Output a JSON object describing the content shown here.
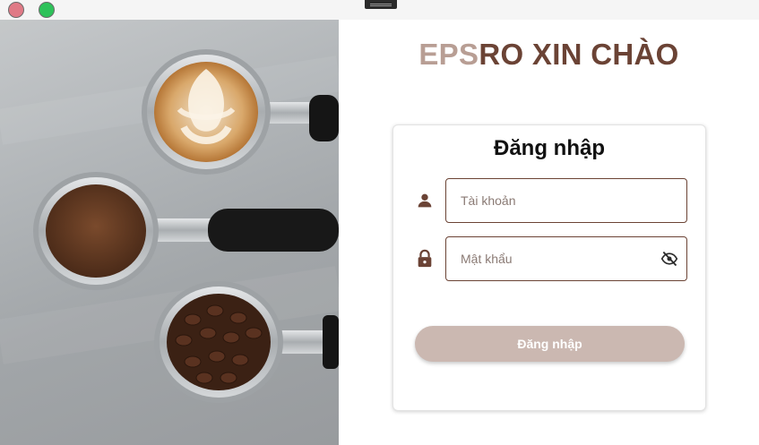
{
  "window": {
    "controls": [
      "close",
      "maximize"
    ],
    "colors": {
      "close": "#e07a86",
      "maximize": "#2ec25a"
    }
  },
  "hero": {
    "image": "portafilters-with-latte-ground-coffee-and-beans"
  },
  "brand": {
    "part1": "EPS",
    "part2": "RO XIN CHÀO",
    "colors": {
      "part1": "#b89e94",
      "part2": "#6b4335"
    }
  },
  "login": {
    "title": "Đăng nhập",
    "username": {
      "placeholder": "Tài khoản",
      "value": "",
      "icon": "person-icon"
    },
    "password": {
      "placeholder": "Mật khẩu",
      "value": "",
      "icon": "lock-icon",
      "toggle_icon": "eye-off-icon"
    },
    "submit_label": "Đăng nhập",
    "colors": {
      "accent": "#6b4335",
      "button": "#cbb8b1"
    }
  }
}
